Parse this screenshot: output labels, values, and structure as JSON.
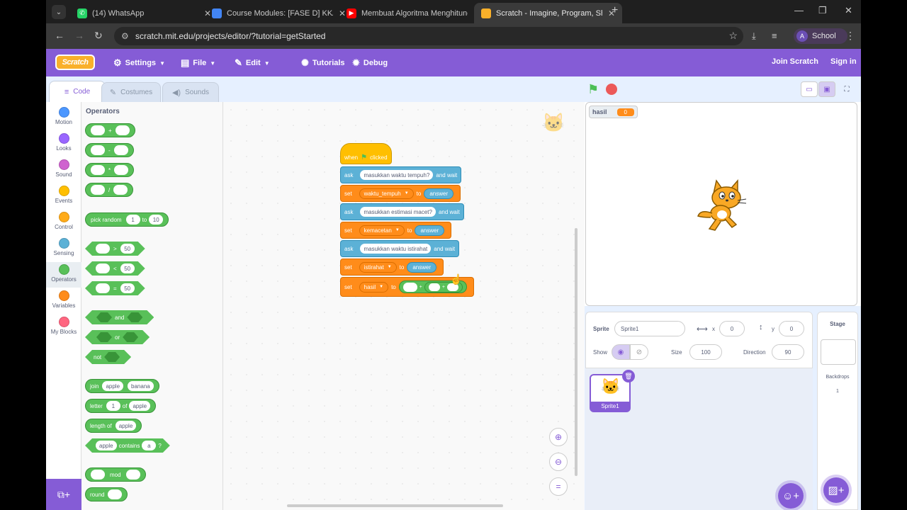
{
  "browser": {
    "tabs": [
      {
        "title": "(14) WhatsApp",
        "icon": "whatsapp-icon",
        "color": "#25d366"
      },
      {
        "title": "Course Modules: [FASE D] KKA",
        "icon": "document-icon",
        "color": "#4285f4"
      },
      {
        "title": "Membuat Algoritma Menghitung",
        "icon": "youtube-icon",
        "color": "#ff0000"
      },
      {
        "title": "Scratch - Imagine, Program, Sha",
        "icon": "scratch-icon",
        "color": "#f9b02a"
      }
    ],
    "url": "scratch.mit.edu/projects/editor/?tutorial=getStarted",
    "profile_initial": "A",
    "profile_label": "School"
  },
  "menubar": {
    "logo": "Scratch",
    "settings": "Settings",
    "file": "File",
    "edit": "Edit",
    "tutorials": "Tutorials",
    "debug": "Debug",
    "join": "Join Scratch",
    "signin": "Sign in"
  },
  "editor_tabs": {
    "code": "Code",
    "costumes": "Costumes",
    "sounds": "Sounds"
  },
  "categories": [
    {
      "label": "Motion",
      "color": "#4c97ff"
    },
    {
      "label": "Looks",
      "color": "#9966ff"
    },
    {
      "label": "Sound",
      "color": "#cf63cf"
    },
    {
      "label": "Events",
      "color": "#ffbf00"
    },
    {
      "label": "Control",
      "color": "#ffab19"
    },
    {
      "label": "Sensing",
      "color": "#5cb1d6"
    },
    {
      "label": "Operators",
      "color": "#59c059"
    },
    {
      "label": "Variables",
      "color": "#ff8c1a"
    },
    {
      "label": "My Blocks",
      "color": "#ff6680"
    }
  ],
  "palette": {
    "title": "Operators",
    "ops": [
      "+",
      "-",
      "*",
      "/"
    ],
    "pick_random": {
      "label": "pick random",
      "from": "1",
      "to_label": "to",
      "to": "10"
    },
    "compare": [
      {
        "op": ">",
        "val": "50"
      },
      {
        "op": "<",
        "val": "50"
      },
      {
        "op": "=",
        "val": "50"
      }
    ],
    "and": "and",
    "or": "or",
    "not": "not",
    "join": {
      "label": "join",
      "a": "apple",
      "b": "banana"
    },
    "letter": {
      "label": "letter",
      "n": "1",
      "of": "of",
      "word": "apple"
    },
    "length": {
      "label": "length of",
      "word": "apple"
    },
    "contains": {
      "word": "apple",
      "label": "contains",
      "letter": "a",
      "q": "?"
    },
    "mod": "mod",
    "round": "round"
  },
  "script": {
    "hat": {
      "when": "when",
      "clicked": "clicked"
    },
    "ask_label": "ask",
    "and_wait": "and wait",
    "set_label": "set",
    "to_label": "to",
    "answer": "answer",
    "ask1": "masukkan waktu tempuh?",
    "set1": "waktu_tempuh",
    "ask2": "masukkan estimasi macet?",
    "set2": "kemacetan",
    "ask3": "masukkan waktu istirahat",
    "set3": "istirahat",
    "set4": "hasil",
    "plus": "+"
  },
  "stage": {
    "monitor_name": "hasil",
    "monitor_value": "0"
  },
  "sprite_info": {
    "sprite_label": "Sprite",
    "sprite_name": "Sprite1",
    "x_label": "x",
    "x": "0",
    "y_label": "y",
    "y": "0",
    "show_label": "Show",
    "size_label": "Size",
    "size": "100",
    "direction_label": "Direction",
    "direction": "90",
    "thumb_label": "Sprite1"
  },
  "stage_panel": {
    "title": "Stage",
    "backdrops_label": "Backdrops",
    "backdrops_count": "1"
  }
}
